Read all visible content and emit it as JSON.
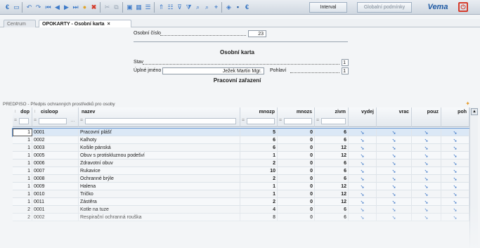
{
  "toolbar": {
    "interval_label": "Interval",
    "conditions_label": "Globalní podmínky",
    "brand": "Vema",
    "icons": [
      "app-icon",
      "screen-icon",
      "undo-icon",
      "redo-icon",
      "first-icon",
      "prev-icon",
      "next-icon",
      "last-icon",
      "new-icon",
      "delete-icon",
      "cut-icon",
      "copy-icon",
      "save-icon",
      "table-icon",
      "list-icon",
      "filter-icon",
      "sort-icon",
      "filter-clear-icon",
      "search-icon",
      "search-next-icon",
      "refresh-icon",
      "help-icon",
      "settings-icon",
      "exit-icon"
    ]
  },
  "tabs": {
    "centrum": "Centrum",
    "active": "OPOKARTY - Osobní karta",
    "close": "×"
  },
  "form": {
    "osobni_cislo_label": "Osobní číslo",
    "osobni_cislo_value": "23",
    "section_osobni": "Osobní karta",
    "stav_label": "Stav",
    "stav_value": "1",
    "jmeno_label": "Úplné jméno",
    "jmeno_value": "Ježek Martin Mgr.",
    "pohlavi_label": "Pohlaví",
    "pohlavi_value": "1",
    "section_pracovni": "Pracovní zařazení"
  },
  "grid": {
    "caption": "PREDPISO - Předpis ochranných prostředků pro osoby",
    "columns": [
      "dop",
      "cisloop",
      "nazev",
      "mnozp",
      "mnozs",
      "zivm",
      "vydej",
      "vrac",
      "pouz",
      "poh"
    ],
    "filter_op": "=",
    "rows": [
      {
        "dop": "1",
        "cisloop": "0001",
        "nazev": "Pracovní plášť",
        "mnozp": "5",
        "mnozs": "0",
        "zivm": "6"
      },
      {
        "dop": "1",
        "cisloop": "0002",
        "nazev": "Kalhoty",
        "mnozp": "6",
        "mnozs": "0",
        "zivm": "6"
      },
      {
        "dop": "1",
        "cisloop": "0003",
        "nazev": "Košile pánská",
        "mnozp": "6",
        "mnozs": "0",
        "zivm": "12"
      },
      {
        "dop": "1",
        "cisloop": "0005",
        "nazev": "Obuv s protiskluznou podešví",
        "mnozp": "1",
        "mnozs": "0",
        "zivm": "12"
      },
      {
        "dop": "1",
        "cisloop": "0006",
        "nazev": "Zdravotní obuv",
        "mnozp": "2",
        "mnozs": "0",
        "zivm": "6"
      },
      {
        "dop": "1",
        "cisloop": "0007",
        "nazev": "Rukavice",
        "mnozp": "10",
        "mnozs": "0",
        "zivm": "6"
      },
      {
        "dop": "1",
        "cisloop": "0008",
        "nazev": "Ochranné brýle",
        "mnozp": "2",
        "mnozs": "0",
        "zivm": "6"
      },
      {
        "dop": "1",
        "cisloop": "0009",
        "nazev": "Halena",
        "mnozp": "1",
        "mnozs": "0",
        "zivm": "12"
      },
      {
        "dop": "1",
        "cisloop": "0010",
        "nazev": "Tričko",
        "mnozp": "1",
        "mnozs": "0",
        "zivm": "12"
      },
      {
        "dop": "1",
        "cisloop": "0011",
        "nazev": "Zástěra",
        "mnozp": "2",
        "mnozs": "0",
        "zivm": "12"
      },
      {
        "dop": "2",
        "cisloop": "0001",
        "nazev": "Kotle na tuze",
        "mnozp": "4",
        "mnozs": "0",
        "zivm": "6"
      },
      {
        "dop": "2",
        "cisloop": "0002",
        "nazev": "Respirační ochranná rouška",
        "mnozp": "8",
        "mnozs": "0",
        "zivm": "6"
      }
    ],
    "arrow": "➘"
  }
}
